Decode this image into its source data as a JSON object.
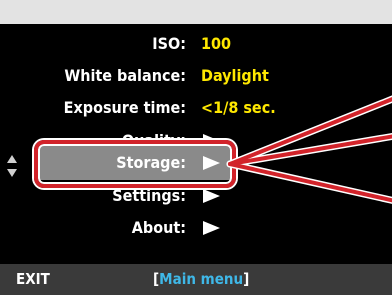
{
  "menu": {
    "iso": {
      "label": "ISO:",
      "value": "100"
    },
    "white_balance": {
      "label": "White balance:",
      "value": "Daylight"
    },
    "exposure_time": {
      "label": "Exposure time:",
      "value": "<1/8 sec."
    },
    "quality": {
      "label": "Quality:"
    },
    "storage": {
      "label": "Storage:"
    },
    "settings": {
      "label": "Settings:"
    },
    "about": {
      "label": "About:"
    },
    "selected_item": "Storage:"
  },
  "footer": {
    "exit_label": "EXIT",
    "bracket_open": "[",
    "screen_title": "Main menu",
    "bracket_close": "]"
  },
  "colors": {
    "value_text": "#ffe800",
    "selection_bar": "#8a8a8a",
    "callout": "#d2232a",
    "footer_title": "#3fb8e8",
    "footer_bar": "#3a3a3a",
    "frame": "#e3e3e3"
  },
  "icons": [
    "scroll-up-icon",
    "scroll-down-icon",
    "submenu-arrow-icon"
  ]
}
